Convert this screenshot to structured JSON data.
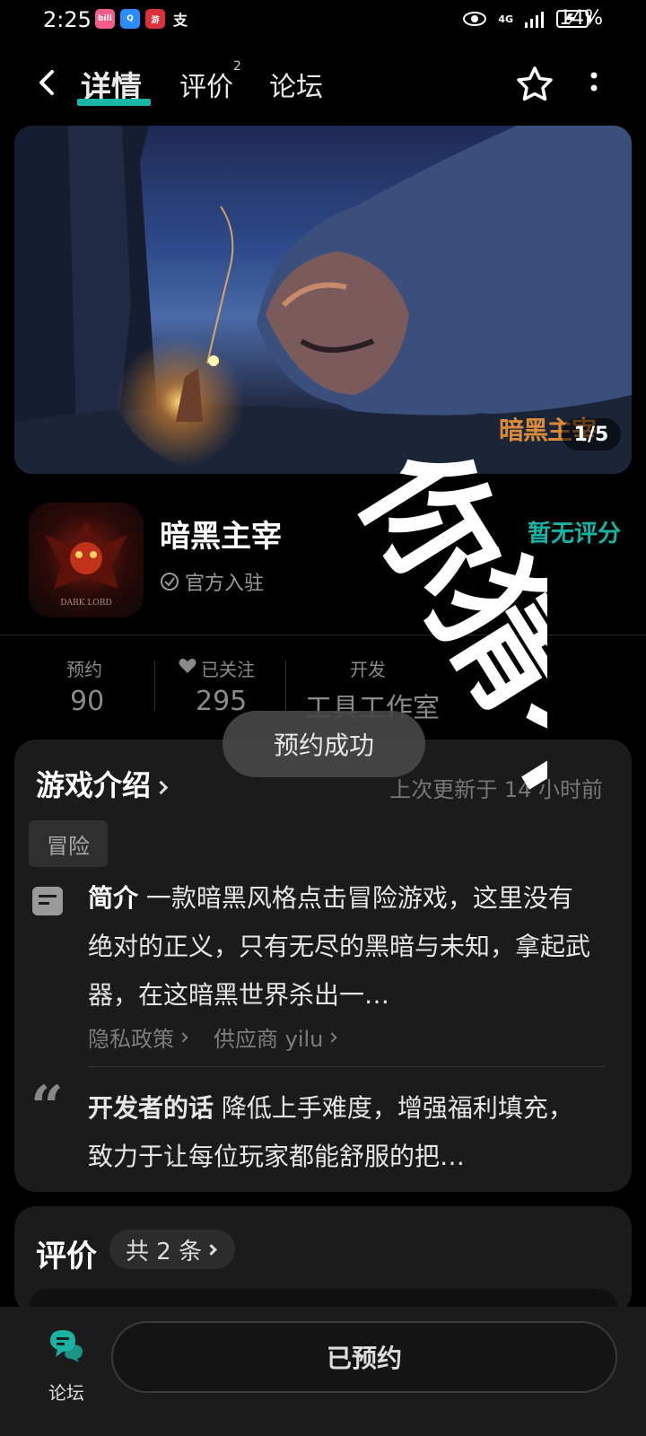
{
  "status_bar": {
    "time": "2:25",
    "battery": "14%",
    "network": "4G",
    "apps": [
      {
        "name": "bilibili-app-icon",
        "label": "bili",
        "color": "#f25d8e"
      },
      {
        "name": "qq-app-icon",
        "label": "Q",
        "color": "#2a8cff"
      },
      {
        "name": "game-app-icon",
        "label": "游",
        "color": "#d9323a"
      },
      {
        "name": "alipay-app-icon",
        "label": "支",
        "color": "#000000"
      }
    ]
  },
  "header": {
    "tabs": [
      {
        "label": "详情",
        "active": true
      },
      {
        "label": "评价",
        "badge": "2"
      },
      {
        "label": "论坛"
      }
    ]
  },
  "banner": {
    "logo_text": "暗黑主宰",
    "counter": "1/5"
  },
  "game": {
    "title": "暗黑主宰",
    "icon_text": "DARK LORD",
    "official": "官方入驻",
    "rating": "暂无评分"
  },
  "stats": {
    "reservations_label": "预约",
    "reservations_value": "90",
    "followed_label": "已关注",
    "followed_value": "295",
    "developer_label": "开发",
    "developer_value": "工具工作室"
  },
  "toast": "预约成功",
  "intro": {
    "title": "游戏介绍",
    "updated": "上次更新于 14 小时前",
    "tag": "冒险",
    "desc_label": "简介",
    "desc": "一款暗黑风格点击冒险游戏，这里没有绝对的正义，只有无尽的黑暗与未知，拿起武器，在这暗黑世界杀出一…",
    "privacy_link": "隐私政策",
    "supplier_link": "供应商 yilu",
    "dev_label": "开发者的话",
    "dev_text": "降低上手难度，增强福利填充，致力于让每位玩家都能舒服的把…"
  },
  "reviews": {
    "title": "评价",
    "count": "共 2 条"
  },
  "bottom": {
    "forum_label": "论坛",
    "reserved_button": "已预约"
  },
  "watermark": {
    "text": "你猜不到"
  },
  "colors": {
    "accent": "#19b3a3",
    "background": "#000000",
    "card": "#1b1b1b"
  }
}
